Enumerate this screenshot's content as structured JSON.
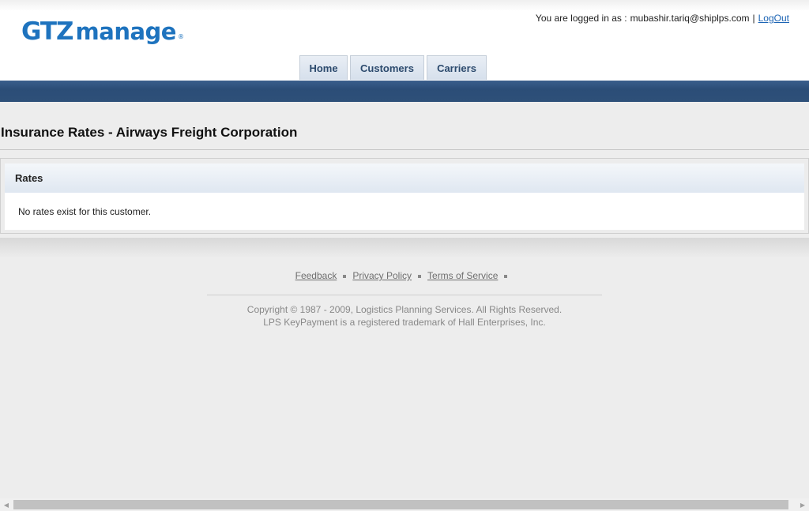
{
  "logo": {
    "part1": "GTZ",
    "part2": "manage",
    "mark": "®"
  },
  "session": {
    "prefix": "You are logged in as :",
    "user": "mubashir.tariq@shiplps.com",
    "separator": "|",
    "logout": "LogOut"
  },
  "nav": {
    "tabs": [
      "Home",
      "Customers",
      "Carriers"
    ]
  },
  "page": {
    "title": "Insurance Rates - Airways Freight Corporation"
  },
  "rates_panel": {
    "header": "Rates",
    "empty_message": "No rates exist for this customer."
  },
  "footer": {
    "links": [
      "Feedback",
      "Privacy Policy",
      "Terms of Service"
    ],
    "copyright_line1": "Copyright © 1987 - 2009, Logistics Planning Services. All Rights Reserved.",
    "copyright_line2": "LPS KeyPayment is a registered trademark of Hall Enterprises, Inc."
  },
  "scrollbar": {
    "left_icon": "triangle-left-icon",
    "right_icon": "triangle-right-icon"
  },
  "colors": {
    "brand_blue": "#1e73be",
    "nav_bar": "#2b4d77",
    "tab_text": "#2c4a6d",
    "link": "#1c64b4"
  }
}
